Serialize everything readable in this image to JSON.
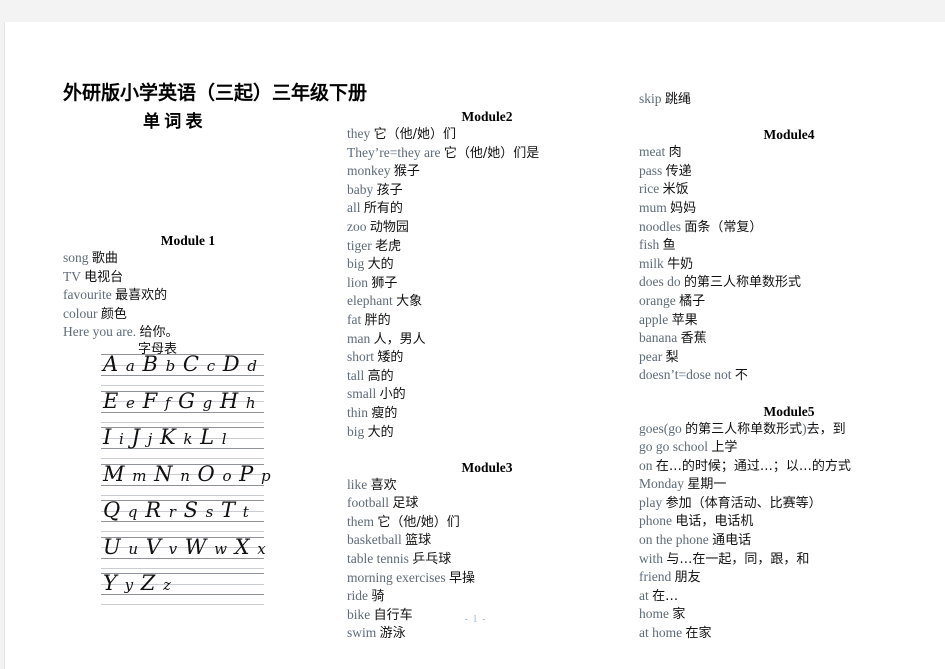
{
  "document": {
    "title": "外研版小学英语（三起）三年级下册",
    "subtitle": "单  词  表",
    "page_number": "- 1 -",
    "alphabet_caption": "字母表",
    "english_word_color": "#5e6b7a",
    "chinese_text_color": "#111111",
    "page_background": "#ffffff",
    "canvas_background": "#f3f3f3"
  },
  "alphabet_chart": {
    "caption": "字母表",
    "rows": [
      "A a B b C c D d",
      "E e F f G g H h",
      "I i J j K k L l",
      "M m N n O o P p",
      "Q q R r S s T t",
      "U u V v W w X x",
      "Y y Z z"
    ]
  },
  "columns": [
    {
      "id": "column-1",
      "blocks": [
        {
          "heading": "Module  1",
          "entries": [
            {
              "en": "song",
              "cn": "歌曲"
            },
            {
              "en": "TV",
              "cn": "电视台"
            },
            {
              "en": "favourite",
              "cn": "最喜欢的"
            },
            {
              "en": "colour",
              "cn": "颜色"
            },
            {
              "en": "Here  you  are.",
              "cn": "给你。"
            }
          ]
        }
      ]
    },
    {
      "id": "column-2",
      "blocks": [
        {
          "heading": "Module2",
          "entries": [
            {
              "en": "they",
              "cn": "它（他/她）们"
            },
            {
              "en": "They’re=they  are",
              "cn": "它（他/她）们是"
            },
            {
              "en": "monkey",
              "cn": "猴子"
            },
            {
              "en": "baby",
              "cn": "孩子"
            },
            {
              "en": "all",
              "cn": "所有的"
            },
            {
              "en": "zoo",
              "cn": "动物园"
            },
            {
              "en": "tiger",
              "cn": "老虎"
            },
            {
              "en": "big",
              "cn": "大的"
            },
            {
              "en": "lion",
              "cn": "狮子"
            },
            {
              "en": "elephant",
              "cn": "大象"
            },
            {
              "en": "fat",
              "cn": "胖的"
            },
            {
              "en": "man",
              "cn": "人，男人"
            },
            {
              "en": "short",
              "cn": "矮的"
            },
            {
              "en": "tall",
              "cn": "高的"
            },
            {
              "en": "small",
              "cn": "小的"
            },
            {
              "en": "thin",
              "cn": "瘦的"
            },
            {
              "en": "big",
              "cn": "大的"
            }
          ]
        },
        {
          "heading": "Module3",
          "entries": [
            {
              "en": "like",
              "cn": "喜欢"
            },
            {
              "en": "football",
              "cn": "足球"
            },
            {
              "en": "them",
              "cn": "它（他/她）们"
            },
            {
              "en": "basketball",
              "cn": "篮球"
            },
            {
              "en": "table  tennis",
              "cn": "乒乓球"
            },
            {
              "en": "morning  exercises",
              "cn": "早操"
            },
            {
              "en": "ride",
              "cn": "骑"
            },
            {
              "en": "bike",
              "cn": "自行车"
            },
            {
              "en": "swim",
              "cn": "游泳"
            }
          ]
        }
      ]
    },
    {
      "id": "column-3",
      "blocks": [
        {
          "heading": "",
          "entries": [
            {
              "en": "skip",
              "cn": "跳绳"
            }
          ]
        },
        {
          "heading": "Module4",
          "entries": [
            {
              "en": "meat",
              "cn": "肉"
            },
            {
              "en": "pass",
              "cn": "传递"
            },
            {
              "en": "rice",
              "cn": "米饭"
            },
            {
              "en": "mum",
              "cn": "妈妈"
            },
            {
              "en": "noodles",
              "cn": "面条（常复）"
            },
            {
              "en": "fish",
              "cn": "鱼"
            },
            {
              "en": "milk",
              "cn": "牛奶"
            },
            {
              "en": "does  do",
              "cn": "的第三人称单数形式"
            },
            {
              "en": "orange",
              "cn": "橘子"
            },
            {
              "en": "apple",
              "cn": "苹果"
            },
            {
              "en": "banana",
              "cn": "香蕉"
            },
            {
              "en": "pear",
              "cn": "梨"
            },
            {
              "en": "doesn’t=dose  not",
              "cn": "不"
            }
          ]
        },
        {
          "heading": "Module5",
          "entries": [
            {
              "en": "goes(go",
              "cn": "的第三人称单数形式",
              "en_tail": ")",
              "cn_tail": "去，到"
            },
            {
              "en": "go  go  school",
              "cn": "上学"
            },
            {
              "en": "on",
              "cn": "在…的时候；通过…；以…的方式"
            },
            {
              "en": "Monday",
              "cn": "星期一"
            },
            {
              "en": "play",
              "cn": "参加（体育活动、比赛等）"
            },
            {
              "en": "phone",
              "cn": "电话，电话机"
            },
            {
              "en": "on  the  phone",
              "cn": "通电话"
            },
            {
              "en": "with",
              "cn": "与…在一起，同，跟，和"
            },
            {
              "en": "friend",
              "cn": "朋友"
            },
            {
              "en": "at",
              "cn": "在…"
            },
            {
              "en": "home",
              "cn": "家"
            },
            {
              "en": "at  home",
              "cn": "在家"
            }
          ]
        }
      ]
    }
  ]
}
